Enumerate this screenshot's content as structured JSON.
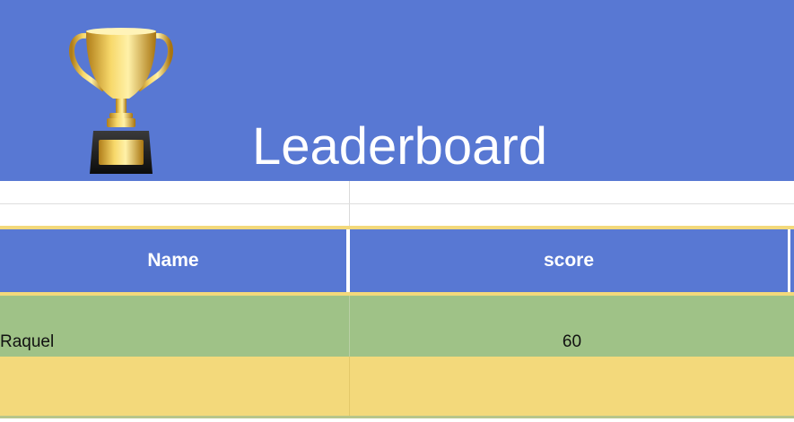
{
  "banner": {
    "title": "Leaderboard",
    "trophy_icon": "trophy-icon"
  },
  "table": {
    "headers": [
      "Name",
      "score"
    ],
    "rows": [
      {
        "name": "Raquel",
        "score": "60"
      },
      {
        "name": "",
        "score": ""
      }
    ]
  },
  "colors": {
    "header_blue": "#5878d3",
    "row_green": "#9fc287",
    "row_yellow": "#f3d97b",
    "accent_border": "#f3d97b"
  }
}
